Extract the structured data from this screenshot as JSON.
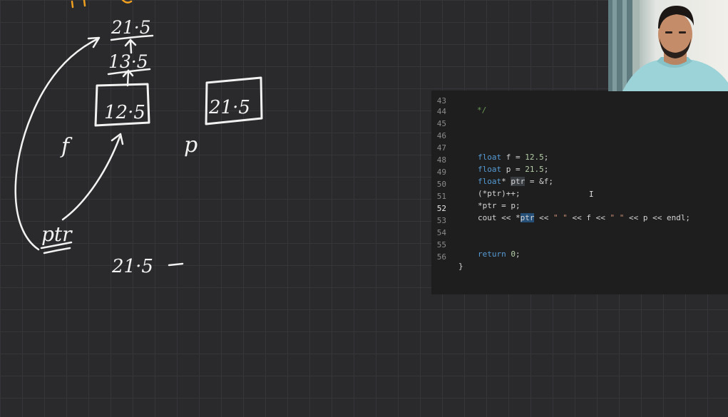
{
  "whiteboard": {
    "top_value": "21·5",
    "mid_value": "13·5",
    "box_f_value": "12·5",
    "box_p_value": "21·5",
    "label_f": "f",
    "label_p": "p",
    "label_ptr": "ptr",
    "output_value": "21·5"
  },
  "editor": {
    "lines": [
      {
        "num": "43",
        "code": "*/"
      },
      {
        "num": "44",
        "code": ""
      },
      {
        "num": "45",
        "code": ""
      },
      {
        "num": "46",
        "code": ""
      },
      {
        "num": "47",
        "code": "float f = 12.5;"
      },
      {
        "num": "48",
        "code": "float p = 21.5;"
      },
      {
        "num": "49",
        "code": "float* ptr = &f;"
      },
      {
        "num": "50",
        "code": "(*ptr)++;"
      },
      {
        "num": "51",
        "code": "*ptr = p;"
      },
      {
        "num": "52",
        "code": "cout << *ptr << \" \" << f << \" \" << p << endl;"
      },
      {
        "num": "53",
        "code": ""
      },
      {
        "num": "54",
        "code": ""
      },
      {
        "num": "55",
        "code": "return 0;"
      },
      {
        "num": "56",
        "code": "}"
      }
    ],
    "active_line": "52",
    "selected_token": "ptr"
  },
  "colors": {
    "board_bg": "#2a2a2c",
    "editor_bg": "#1e1e1e",
    "keyword": "#569cd6",
    "number": "#b5cea8",
    "string": "#ce9178",
    "comment": "#6a9955",
    "selection": "#264f78",
    "chalk": "#f2f2f2"
  }
}
